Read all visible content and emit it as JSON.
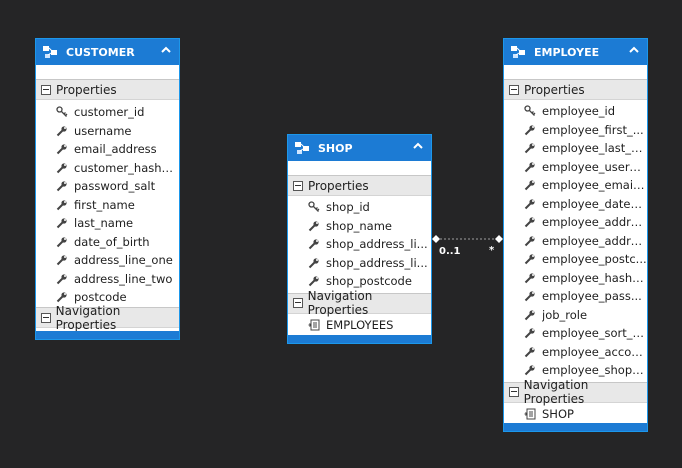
{
  "customer": {
    "title": "CUSTOMER",
    "properties_label": "Properties",
    "properties": [
      {
        "name": "customer_id",
        "key": true
      },
      {
        "name": "username"
      },
      {
        "name": "email_address"
      },
      {
        "name": "customer_hashe..."
      },
      {
        "name": "password_salt"
      },
      {
        "name": "first_name"
      },
      {
        "name": "last_name"
      },
      {
        "name": "date_of_birth"
      },
      {
        "name": "address_line_one"
      },
      {
        "name": "address_line_two"
      },
      {
        "name": "postcode"
      }
    ],
    "nav_label": "Navigation Properties",
    "nav_properties": []
  },
  "shop": {
    "title": "SHOP",
    "properties_label": "Properties",
    "properties": [
      {
        "name": "shop_id",
        "key": true
      },
      {
        "name": "shop_name"
      },
      {
        "name": "shop_address_li..."
      },
      {
        "name": "shop_address_li..."
      },
      {
        "name": "shop_postcode"
      }
    ],
    "nav_label": "Navigation Properties",
    "nav_properties": [
      {
        "name": "EMPLOYEES"
      }
    ]
  },
  "employee": {
    "title": "EMPLOYEE",
    "properties_label": "Properties",
    "properties": [
      {
        "name": "employee_id",
        "key": true
      },
      {
        "name": "employee_first_..."
      },
      {
        "name": "employee_last_n..."
      },
      {
        "name": "employee_usern..."
      },
      {
        "name": "employee_email..."
      },
      {
        "name": "employee_date_..."
      },
      {
        "name": "employee_addre..."
      },
      {
        "name": "employee_addre..."
      },
      {
        "name": "employee_postc..."
      },
      {
        "name": "employee_hashe..."
      },
      {
        "name": "employee_pass..."
      },
      {
        "name": "job_role"
      },
      {
        "name": "employee_sort_c..."
      },
      {
        "name": "employee_accou..."
      },
      {
        "name": "employee_shop_..."
      }
    ],
    "nav_label": "Navigation Properties",
    "nav_properties": [
      {
        "name": "SHOP"
      }
    ]
  },
  "association": {
    "from_multiplicity": "0..1",
    "to_multiplicity": "*",
    "line_color": "#a0a0a0"
  },
  "colors": {
    "header": "#1c7bd4",
    "border": "#1c97ea",
    "background": "#252526"
  }
}
